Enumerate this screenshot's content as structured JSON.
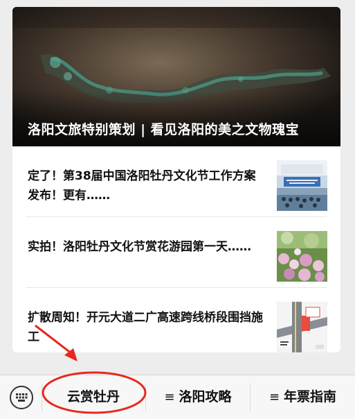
{
  "hero": {
    "title": "洛阳文旅特别策划 | 看见洛阳的美之文物瑰宝"
  },
  "news": [
    {
      "title": "定了！第38届中国洛阳牡丹文化节工作方案发布！更有……",
      "thumb_icon": "press-conference-photo"
    },
    {
      "title": "实拍！洛阳牡丹文化节赏花游园第一天……",
      "thumb_icon": "peony-garden-photo"
    },
    {
      "title": "扩散周知！开元大道二广高速跨线桥段围挡施工",
      "thumb_icon": "road-construction-map"
    }
  ],
  "menu": {
    "keyboard_icon": "keyboard-icon",
    "items": [
      {
        "label": "云赏牡丹",
        "has_submenu": false
      },
      {
        "label": "洛阳攻略",
        "has_submenu": true
      },
      {
        "label": "年票指南",
        "has_submenu": true
      }
    ],
    "submenu_glyph": "≡"
  },
  "colors": {
    "annotation": "#e8271e",
    "background": "#ededed"
  }
}
